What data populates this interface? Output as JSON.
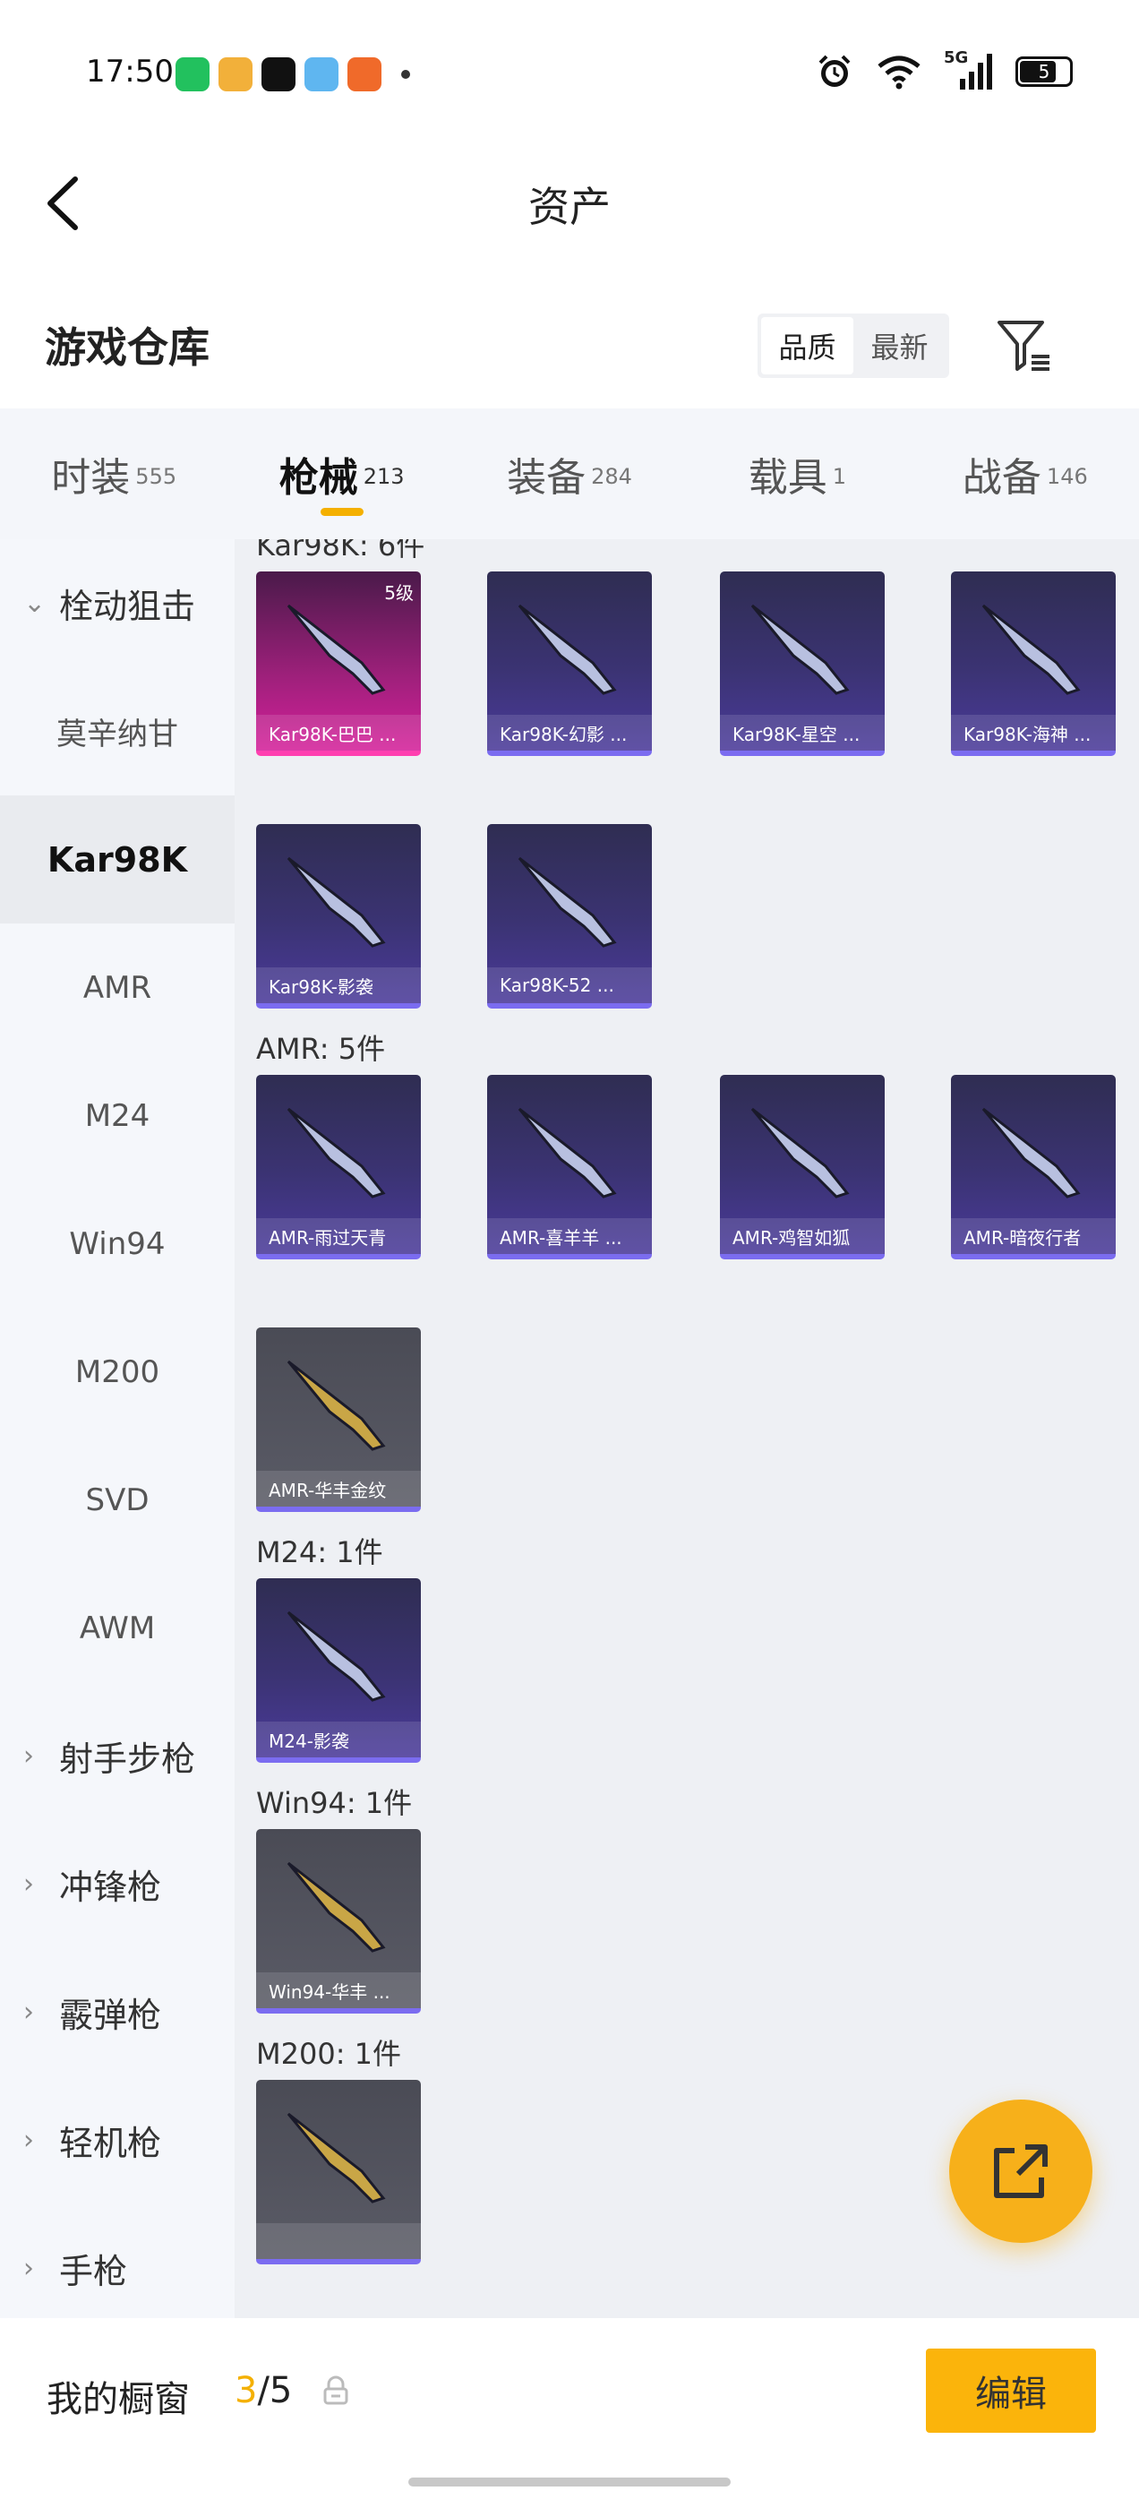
{
  "status_bar": {
    "time": "17:50",
    "network": "5G",
    "battery": "5"
  },
  "header": {
    "title": "资产"
  },
  "warehouse": {
    "title": "游戏仓库",
    "sort_options": [
      "品质",
      "最新"
    ],
    "active_sort": 0
  },
  "tabs": [
    {
      "label": "时装",
      "count": "555"
    },
    {
      "label": "枪械",
      "count": "213",
      "active": true
    },
    {
      "label": "装备",
      "count": "284"
    },
    {
      "label": "载具",
      "count": "1"
    },
    {
      "label": "战备",
      "count": "146"
    }
  ],
  "sidebar": {
    "items": [
      {
        "label": "栓动狙击",
        "group": true,
        "expanded": true
      },
      {
        "label": "莫辛纳甘"
      },
      {
        "label": "Kar98K",
        "active": true
      },
      {
        "label": "AMR"
      },
      {
        "label": "M24"
      },
      {
        "label": "Win94"
      },
      {
        "label": "M200"
      },
      {
        "label": "SVD"
      },
      {
        "label": "AWM"
      },
      {
        "label": "射手步枪",
        "group": true
      },
      {
        "label": "冲锋枪",
        "group": true
      },
      {
        "label": "霰弹枪",
        "group": true
      },
      {
        "label": "轻机枪",
        "group": true
      },
      {
        "label": "手枪",
        "group": true
      }
    ]
  },
  "sections": [
    {
      "title": "Kar98K: 6件",
      "items": [
        {
          "label": "Kar98K-巴巴 ...",
          "badge": "5级",
          "style": "pink"
        },
        {
          "label": "Kar98K-幻影 ...",
          "style": "purple"
        },
        {
          "label": "Kar98K-星空 ...",
          "style": "purple"
        },
        {
          "label": "Kar98K-海神 ...",
          "style": "purple"
        },
        {
          "label": "Kar98K-影袭",
          "style": "purple"
        },
        {
          "label": "Kar98K-52 ...",
          "style": "purple"
        }
      ]
    },
    {
      "title": "AMR: 5件",
      "items": [
        {
          "label": "AMR-雨过天青",
          "style": "purple"
        },
        {
          "label": "AMR-喜羊羊 ...",
          "style": "purple"
        },
        {
          "label": "AMR-鸡智如狐",
          "style": "purple"
        },
        {
          "label": "AMR-暗夜行者",
          "style": "purple"
        },
        {
          "label": "AMR-华丰金纹",
          "style": "gray"
        }
      ]
    },
    {
      "title": "M24: 1件",
      "items": [
        {
          "label": "M24-影袭",
          "style": "purple"
        }
      ]
    },
    {
      "title": "Win94: 1件",
      "items": [
        {
          "label": "Win94-华丰 ...",
          "style": "gray"
        }
      ]
    },
    {
      "title": "M200: 1件",
      "items": [
        {
          "label": "",
          "style": "gray"
        }
      ]
    }
  ],
  "bottom_bar": {
    "showcase_label": "我的橱窗",
    "showcase_current": "3",
    "showcase_total": "/5",
    "edit_label": "编辑"
  },
  "colors": {
    "accent": "#f4b000",
    "button": "#fbb40b",
    "card_purple": "#3b3373",
    "card_pink": "#d4209a"
  }
}
